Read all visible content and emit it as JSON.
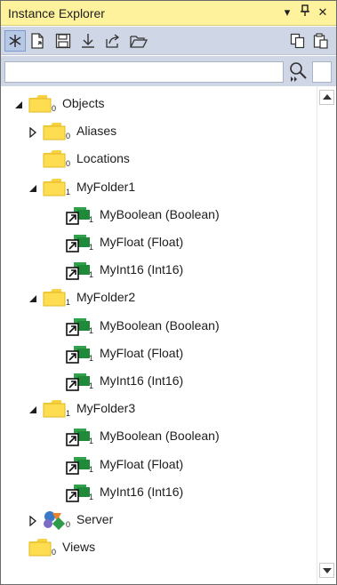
{
  "window": {
    "title": "Instance Explorer",
    "accent_title_bar": "#fff29d",
    "toolbar_bg": "#cfd6e5"
  },
  "titlebar_buttons": [
    {
      "name": "dropdown-arrow-icon",
      "glyph": "▾"
    },
    {
      "name": "pin-icon",
      "glyph": "🖈"
    },
    {
      "name": "close-icon",
      "glyph": "✕"
    }
  ],
  "toolbar": {
    "tools": [
      {
        "name": "asterisk-tool-icon",
        "active": true
      },
      {
        "name": "new-file-tool-icon",
        "active": false
      },
      {
        "name": "save-icon",
        "active": false
      },
      {
        "name": "download-icon",
        "active": false
      },
      {
        "name": "export-icon",
        "active": false
      },
      {
        "name": "open-folder-icon",
        "active": false
      },
      {
        "name": "copy-icon",
        "active": false
      },
      {
        "name": "paste-icon",
        "active": false
      }
    ]
  },
  "search": {
    "value": "",
    "placeholder": ""
  },
  "tree": {
    "nodes": [
      {
        "label": "Objects",
        "count": "0",
        "icon": "folder-icon",
        "expander": "expanded",
        "level": 0
      },
      {
        "label": "Aliases",
        "count": "0",
        "icon": "folder-icon",
        "expander": "collapsed",
        "level": 1
      },
      {
        "label": "Locations",
        "count": "0",
        "icon": "folder-icon",
        "expander": "none",
        "level": 1
      },
      {
        "label": "MyFolder1",
        "count": "1",
        "icon": "folder-icon",
        "expander": "expanded",
        "level": 1
      },
      {
        "label": "MyBoolean (Boolean)",
        "count": "1",
        "icon": "variable-link-icon",
        "expander": "none",
        "level": 2
      },
      {
        "label": "MyFloat (Float)",
        "count": "1",
        "icon": "variable-link-icon",
        "expander": "none",
        "level": 2
      },
      {
        "label": "MyInt16 (Int16)",
        "count": "1",
        "icon": "variable-link-icon",
        "expander": "none",
        "level": 2
      },
      {
        "label": "MyFolder2",
        "count": "1",
        "icon": "folder-icon",
        "expander": "expanded",
        "level": 1
      },
      {
        "label": "MyBoolean (Boolean)",
        "count": "1",
        "icon": "variable-link-icon",
        "expander": "none",
        "level": 2
      },
      {
        "label": "MyFloat (Float)",
        "count": "1",
        "icon": "variable-link-icon",
        "expander": "none",
        "level": 2
      },
      {
        "label": "MyInt16 (Int16)",
        "count": "1",
        "icon": "variable-link-icon",
        "expander": "none",
        "level": 2
      },
      {
        "label": "MyFolder3",
        "count": "1",
        "icon": "folder-icon",
        "expander": "expanded",
        "level": 1
      },
      {
        "label": "MyBoolean (Boolean)",
        "count": "1",
        "icon": "variable-link-icon",
        "expander": "none",
        "level": 2
      },
      {
        "label": "MyFloat (Float)",
        "count": "1",
        "icon": "variable-link-icon",
        "expander": "none",
        "level": 2
      },
      {
        "label": "MyInt16 (Int16)",
        "count": "1",
        "icon": "variable-link-icon",
        "expander": "none",
        "level": 2
      },
      {
        "label": "Server",
        "count": "0",
        "icon": "server-shapes-icon",
        "expander": "collapsed",
        "level": 1
      },
      {
        "label": "Views",
        "count": "0",
        "icon": "folder-icon",
        "expander": "none",
        "level": 0
      }
    ]
  },
  "scrollbar": {
    "up": "scroll-up-arrow-icon",
    "down": "scroll-down-arrow-icon"
  }
}
